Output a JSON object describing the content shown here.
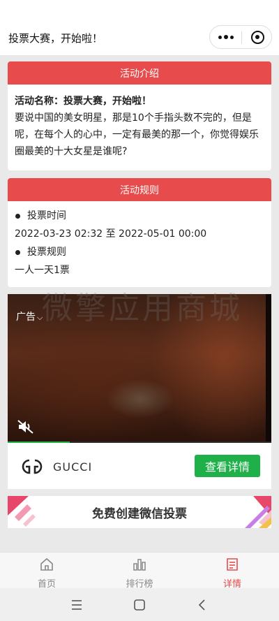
{
  "header": {
    "title": "投票大赛，开始啦！",
    "more_icon": "more-dots-icon",
    "close_icon": "target-close-icon"
  },
  "intro": {
    "heading": "活动介绍",
    "name_label": "活动名称：投票大赛，开始啦！",
    "description": "要说中国的美女明星，那是10个手指头数不完的，但是呢，在每个人的心中，一定有最美的那一个，你觉得娱乐圈最美的十大女星是谁呢?"
  },
  "rules": {
    "heading": "活动规则",
    "time_label": "投票时间",
    "time_value": "2022-03-23 02:32 至 2022-05-01 00:00",
    "rule_label": "投票规则",
    "rule_value": "一人一天1票"
  },
  "ad": {
    "tag": "广告",
    "tag_chevron": "⌵",
    "brand": "GUCCI",
    "cta": "查看详情",
    "progress": 0.235,
    "watermark": "微擎应用商城"
  },
  "banner": {
    "text": "免费创建微信投票"
  },
  "tabs": [
    {
      "label": "首页",
      "icon": "home-icon"
    },
    {
      "label": "排行榜",
      "icon": "bar-chart-icon"
    },
    {
      "label": "详情",
      "icon": "document-icon"
    }
  ],
  "colors": {
    "accent": "#e84b4b",
    "green": "#1fb04a"
  }
}
